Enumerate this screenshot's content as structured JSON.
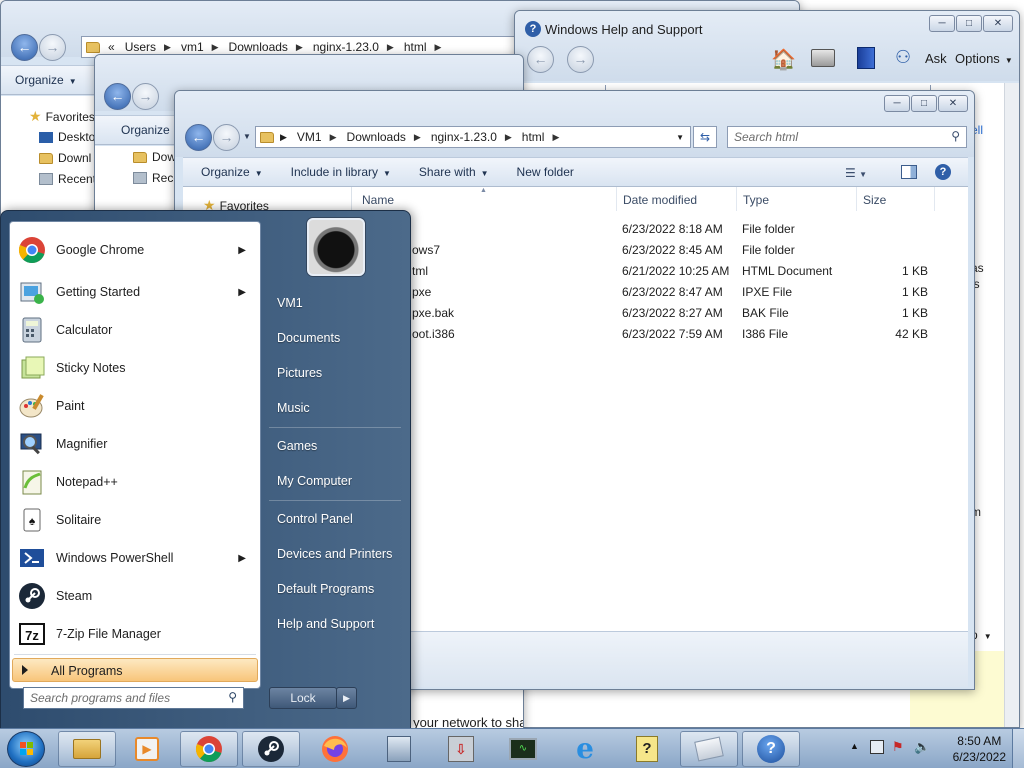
{
  "window_back": {
    "breadcrumb": [
      "«",
      "Users",
      "vm1",
      "Downloads",
      "nginx-1.23.0",
      "html"
    ],
    "organize": "Organize",
    "nav": [
      "Favorites",
      "Deskto",
      "Downl",
      "Recent"
    ]
  },
  "window_mid": {
    "organize": "Organize",
    "nav": [
      "Dow",
      "Rece"
    ]
  },
  "window_main": {
    "breadcrumb": [
      "VM1",
      "Downloads",
      "nginx-1.23.0",
      "html"
    ],
    "search_placeholder": "Search html",
    "commands": [
      "Organize",
      "Include in library",
      "Share with",
      "New folder"
    ],
    "nav_favorites": "Favorites",
    "columns": [
      "Name",
      "Date modified",
      "Type",
      "Size"
    ],
    "rows": [
      {
        "name": "",
        "date": "6/23/2022 8:18 AM",
        "type": "File folder",
        "size": ""
      },
      {
        "name": "ows7",
        "date": "6/23/2022 8:45 AM",
        "type": "File folder",
        "size": ""
      },
      {
        "name": "tml",
        "date": "6/21/2022 10:25 AM",
        "type": "HTML Document",
        "size": "1 KB"
      },
      {
        "name": "pxe",
        "date": "6/23/2022 8:47 AM",
        "type": "IPXE File",
        "size": "1 KB"
      },
      {
        "name": "pxe.bak",
        "date": "6/23/2022 8:27 AM",
        "type": "BAK File",
        "size": "1 KB"
      },
      {
        "name": "oot.i386",
        "date": "6/23/2022 7:59 AM",
        "type": "I386 File",
        "size": "42 KB"
      }
    ]
  },
  "help_window": {
    "title": "Windows Help and Support",
    "ask": "Ask",
    "options": "Options",
    "right_snippets": [
      "ell",
      "as",
      "is",
      "m",
      "p"
    ]
  },
  "bottom_snippet": "on your network to share with",
  "start_menu": {
    "programs": [
      {
        "label": "Google Chrome",
        "icon": "chrome-icon",
        "submenu": true
      },
      {
        "label": "Getting Started",
        "icon": "getting-started-icon",
        "submenu": true
      },
      {
        "label": "Calculator",
        "icon": "calculator-icon",
        "submenu": false
      },
      {
        "label": "Sticky Notes",
        "icon": "sticky-notes-icon",
        "submenu": false
      },
      {
        "label": "Paint",
        "icon": "paint-icon",
        "submenu": false
      },
      {
        "label": "Magnifier",
        "icon": "magnifier-icon",
        "submenu": false
      },
      {
        "label": "Notepad++",
        "icon": "notepad-plus-plus-icon",
        "submenu": false
      },
      {
        "label": "Solitaire",
        "icon": "solitaire-icon",
        "submenu": false
      },
      {
        "label": "Windows PowerShell",
        "icon": "powershell-icon",
        "submenu": true
      },
      {
        "label": "Steam",
        "icon": "steam-icon",
        "submenu": false
      },
      {
        "label": "7-Zip File Manager",
        "icon": "seven-zip-icon",
        "submenu": false
      }
    ],
    "all_programs": "All Programs",
    "search_placeholder": "Search programs and files",
    "right_items": [
      "VM1",
      "Documents",
      "Pictures",
      "Music",
      "Games",
      "My Computer",
      "Control Panel",
      "Devices and Printers",
      "Default Programs",
      "Help and Support"
    ],
    "lock": "Lock"
  },
  "taskbar": {
    "items": [
      "explorer-icon",
      "media-player-icon",
      "chrome-icon",
      "steam-icon",
      "firefox-icon",
      "network-setup-icon",
      "installer-icon",
      "task-manager-icon",
      "internet-explorer-icon",
      "help-file-icon",
      "blank-window-icon",
      "help-support-icon"
    ],
    "time": "8:50 AM",
    "date": "6/23/2022"
  },
  "colors": {
    "accent": "#2f5fa8",
    "all_programs_highlight": "#f8c57a",
    "start_menu_right": "#3d5a7c"
  }
}
